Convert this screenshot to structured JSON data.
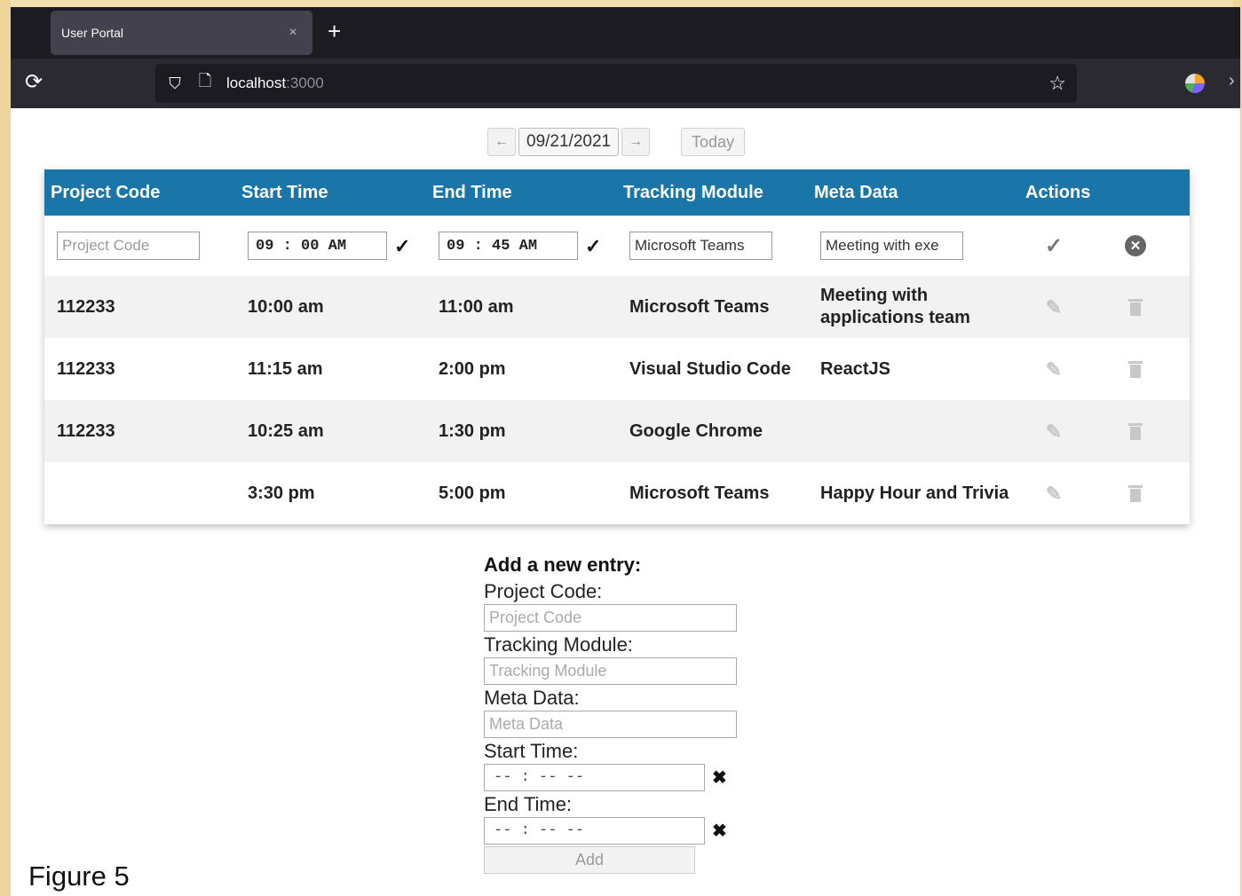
{
  "browser": {
    "tab_title": "User Portal",
    "tab_close": "×",
    "new_tab": "+",
    "reload": "⟳",
    "url_host": "localhost",
    "url_port": ":3000",
    "shield_icon": "⛉",
    "page_icon": "🗋",
    "star_icon": "☆",
    "more": "›"
  },
  "datenav": {
    "prev": "←",
    "date": "09/21/2021",
    "next": "→",
    "today": "Today"
  },
  "table": {
    "headers": [
      "Project Code",
      "Start Time",
      "End Time",
      "Tracking Module",
      "Meta Data",
      "Actions"
    ],
    "edit_row": {
      "project_code_placeholder": "Project Code",
      "start_time": "09 : 00   AM",
      "end_time": "09 : 45   AM",
      "tracking_module": "Microsoft Teams",
      "meta_data": "Meeting with exe",
      "time_check": "✓",
      "save_icon": "✓",
      "cancel_icon": "✕"
    },
    "rows": [
      {
        "project_code": "112233",
        "start": "10:00 am",
        "end": "11:00 am",
        "module": "Microsoft Teams",
        "meta": "Meeting with applications team"
      },
      {
        "project_code": "112233",
        "start": "11:15 am",
        "end": "2:00 pm",
        "module": "Visual Studio Code",
        "meta": "ReactJS"
      },
      {
        "project_code": "112233",
        "start": "10:25 am",
        "end": "1:30 pm",
        "module": "Google Chrome",
        "meta": ""
      },
      {
        "project_code": "",
        "start": "3:30 pm",
        "end": "5:00 pm",
        "module": "Microsoft Teams",
        "meta": "Happy Hour and Trivia"
      }
    ],
    "edit_icon": "✎"
  },
  "form": {
    "title": "Add a new entry:",
    "project_code_label": "Project Code:",
    "project_code_placeholder": "Project Code",
    "tracking_module_label": "Tracking Module:",
    "tracking_module_placeholder": "Tracking Module",
    "meta_data_label": "Meta Data:",
    "meta_data_placeholder": "Meta Data",
    "start_time_label": "Start Time:",
    "end_time_label": "End Time:",
    "time_empty": "-- : --   --",
    "clear": "✖",
    "add_button": "Add"
  },
  "figure_label": "Figure 5"
}
